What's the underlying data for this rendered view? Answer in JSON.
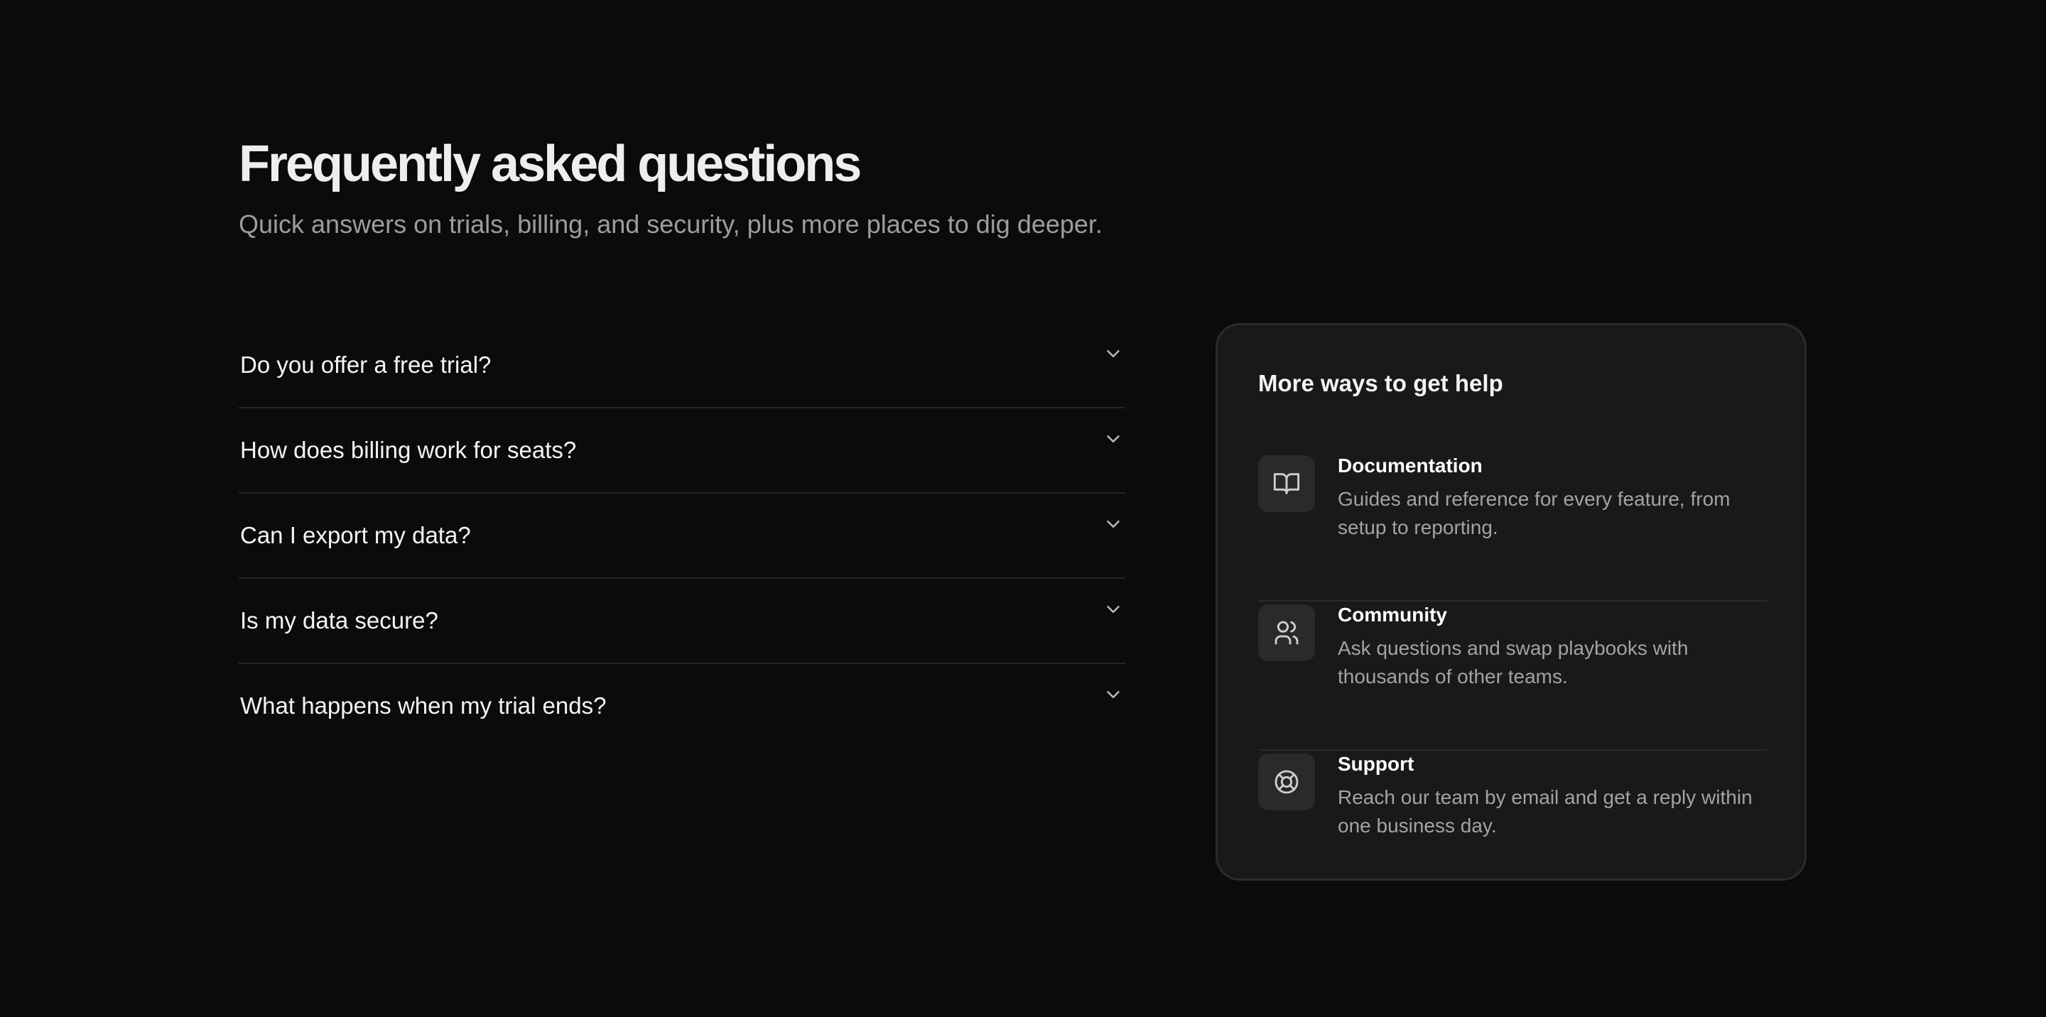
{
  "header": {
    "title": "Frequently asked questions",
    "subtitle": "Quick answers on trials, billing, and security, plus more places to dig deeper."
  },
  "faq": {
    "items": [
      {
        "question": "Do you offer a free trial?",
        "icon": "chevron-down-icon"
      },
      {
        "question": "How does billing work for seats?",
        "icon": "chevron-down-icon"
      },
      {
        "question": "Can I export my data?",
        "icon": "chevron-down-icon"
      },
      {
        "question": "Is my data secure?",
        "icon": "chevron-down-icon"
      },
      {
        "question": "What happens when my trial ends?",
        "icon": "chevron-down-icon"
      }
    ]
  },
  "help": {
    "title": "More ways to get help",
    "items": [
      {
        "title": "Documentation",
        "description": "Guides and reference for every feature, from setup to reporting.",
        "icon": "book-icon"
      },
      {
        "title": "Community",
        "description": "Ask questions and swap playbooks with thousands of other teams.",
        "icon": "users-icon"
      },
      {
        "title": "Support",
        "description": "Reach our team by email and get a reply within one business day.",
        "icon": "lifebuoy-icon"
      }
    ]
  },
  "colors": {
    "background": "#0b0b0b",
    "card": "#191919",
    "divider": "#252525",
    "muted_text": "#9d9d9d"
  }
}
